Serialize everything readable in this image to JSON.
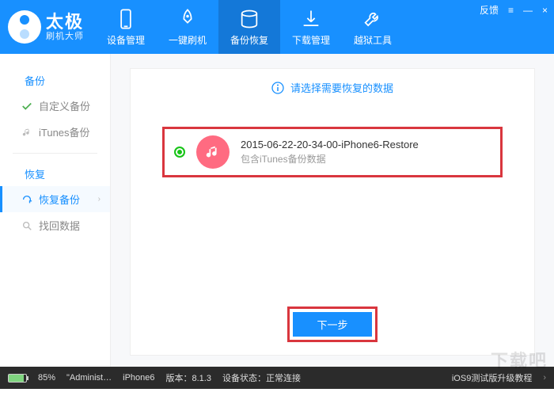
{
  "brand": {
    "name": "太极",
    "subtitle": "刷机大师"
  },
  "header_tabs": [
    {
      "label": "设备管理"
    },
    {
      "label": "一键刷机"
    },
    {
      "label": "备份恢复"
    },
    {
      "label": "下载管理"
    },
    {
      "label": "越狱工具"
    }
  ],
  "window": {
    "feedback": "反馈",
    "menu": "≡",
    "min": "—",
    "close": "×"
  },
  "sidebar": {
    "group_backup": "备份",
    "items_backup": [
      {
        "label": "自定义备份"
      },
      {
        "label": "iTunes备份"
      }
    ],
    "group_restore": "恢复",
    "items_restore": [
      {
        "label": "恢复备份"
      },
      {
        "label": "找回数据"
      }
    ]
  },
  "content": {
    "info": "请选择需要恢复的数据",
    "backup": {
      "title": "2015-06-22-20-34-00-iPhone6-Restore",
      "subtitle": "包含iTunes备份数据"
    },
    "next": "下一步"
  },
  "status": {
    "battery_pct": "85%",
    "user": "\"Administ…",
    "device": "iPhone6",
    "version_label": "版本：",
    "version": "8.1.3",
    "conn_label": "设备状态：",
    "conn": "正常连接",
    "promo": "iOS9测试版升级教程"
  },
  "watermark": "下载吧"
}
